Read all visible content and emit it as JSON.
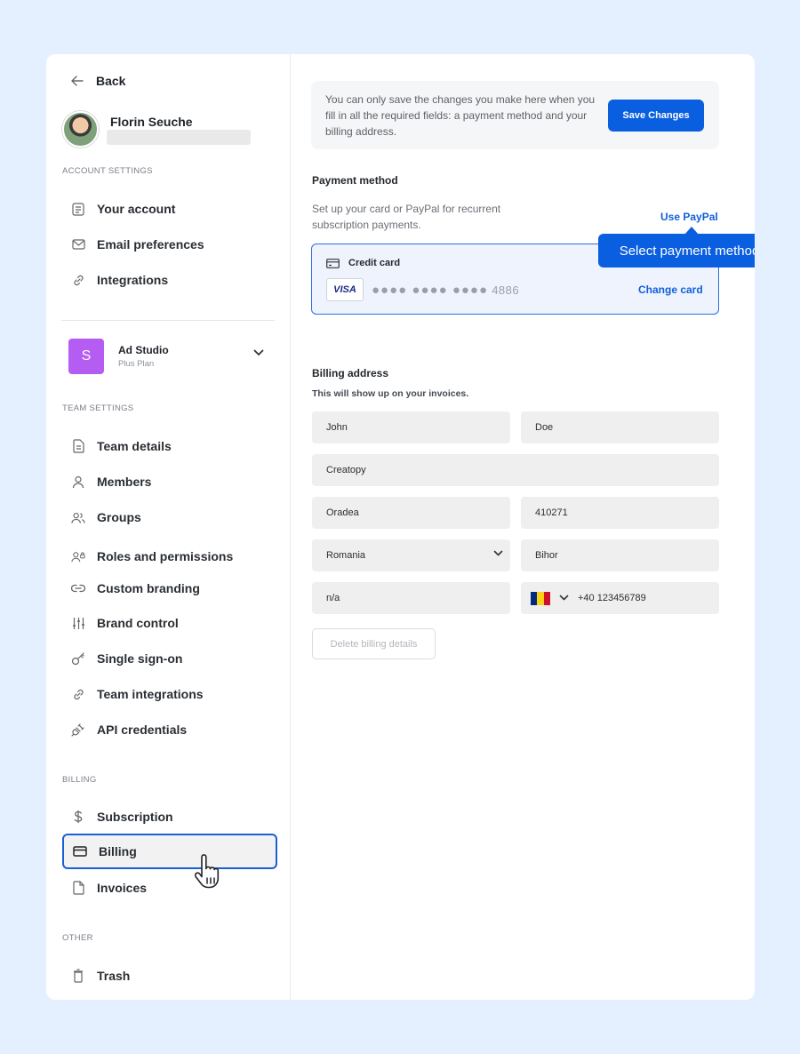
{
  "sidebar": {
    "back_label": "Back",
    "user_name": "Florin Seuche",
    "account_section": "ACCOUNT SETTINGS",
    "account_items": [
      {
        "label": "Your account",
        "icon": "document-icon"
      },
      {
        "label": "Email preferences",
        "icon": "envelope-icon"
      },
      {
        "label": "Integrations",
        "icon": "link-icon"
      }
    ],
    "team": {
      "logo_letter": "S",
      "name": "Ad Studio",
      "plan": "Plus Plan"
    },
    "team_section": "TEAM SETTINGS",
    "team_items": [
      {
        "label": "Team details",
        "icon": "document-icon"
      },
      {
        "label": "Members",
        "icon": "user-icon"
      },
      {
        "label": "Groups",
        "icon": "users-icon"
      },
      {
        "label": "Roles and permissions",
        "icon": "user-lock-icon"
      },
      {
        "label": "Custom branding",
        "icon": "link-icon"
      },
      {
        "label": "Brand control",
        "icon": "sliders-icon"
      },
      {
        "label": "Single sign-on",
        "icon": "key-icon"
      },
      {
        "label": "Team integrations",
        "icon": "link-icon"
      },
      {
        "label": "API credentials",
        "icon": "plug-icon"
      }
    ],
    "billing_section": "BILLING",
    "billing_items": [
      {
        "label": "Subscription",
        "icon": "dollar-icon"
      },
      {
        "label": "Billing",
        "icon": "credit-card-icon",
        "active": true
      },
      {
        "label": "Invoices",
        "icon": "file-icon"
      }
    ],
    "other_section": "OTHER",
    "other_items": [
      {
        "label": "Trash",
        "icon": "trash-icon"
      }
    ]
  },
  "notice": {
    "text": "You can only save the changes you make here when you fill in all the required fields: a payment method and your billing address.",
    "save_label": "Save Changes"
  },
  "payment": {
    "title": "Payment method",
    "description": "Set up your card or PayPal for recurrent subscription payments.",
    "paypal_link": "Use PayPal",
    "tooltip": "Select payment method",
    "card_type": "Credit card",
    "card_brand": "VISA",
    "card_masked": "●●●● ●●●● ●●●●",
    "card_last4": "4886",
    "change_card": "Change card"
  },
  "billing": {
    "title": "Billing address",
    "description": "This will show up on your invoices.",
    "first_name": "John",
    "last_name": "Doe",
    "company": "Creatopy",
    "city": "Oradea",
    "postal_code": "410271",
    "country": "Romania",
    "county": "Bihor",
    "vat": "n/a",
    "phone": "+40 123456789",
    "delete_label": "Delete billing details"
  },
  "colors": {
    "accent": "#0a5ee0",
    "team_logo": "#b55cf2",
    "background": "#e4efff"
  }
}
